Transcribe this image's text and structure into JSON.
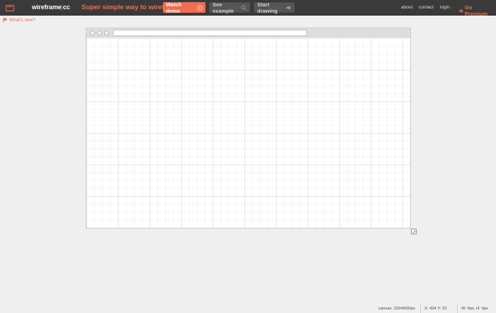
{
  "header": {
    "brand_main": "wireframe",
    "brand_sep": "|",
    "brand_suffix": "cc",
    "tagline": "Super simple way to wireframe",
    "buttons": {
      "watch_demo": "Watch demo",
      "see_example": "See example",
      "start_drawing": "Start drawing"
    },
    "nav": {
      "about": "about",
      "contact": "contact",
      "login": "login"
    },
    "premium": "Go Premium"
  },
  "notice": {
    "whats_new": "What's new?"
  },
  "browser": {
    "url": ""
  },
  "status": {
    "canvas": "canvas: 1024/600px",
    "xy": "X: 424 Y: 22",
    "wh": "W: 0px, H: 0px"
  },
  "colors": {
    "accent": "#f26c4f",
    "topbar": "#3a3a3a",
    "background": "#efefef"
  },
  "icons": {
    "logo": "browser-window-icon",
    "watch_demo": "play-circle-icon",
    "see_example": "magnifier-icon",
    "start_drawing": "megaphone-icon",
    "premium": "arrow-right-icon",
    "whats_new": "flag-icon",
    "resize": "resize-icon"
  }
}
